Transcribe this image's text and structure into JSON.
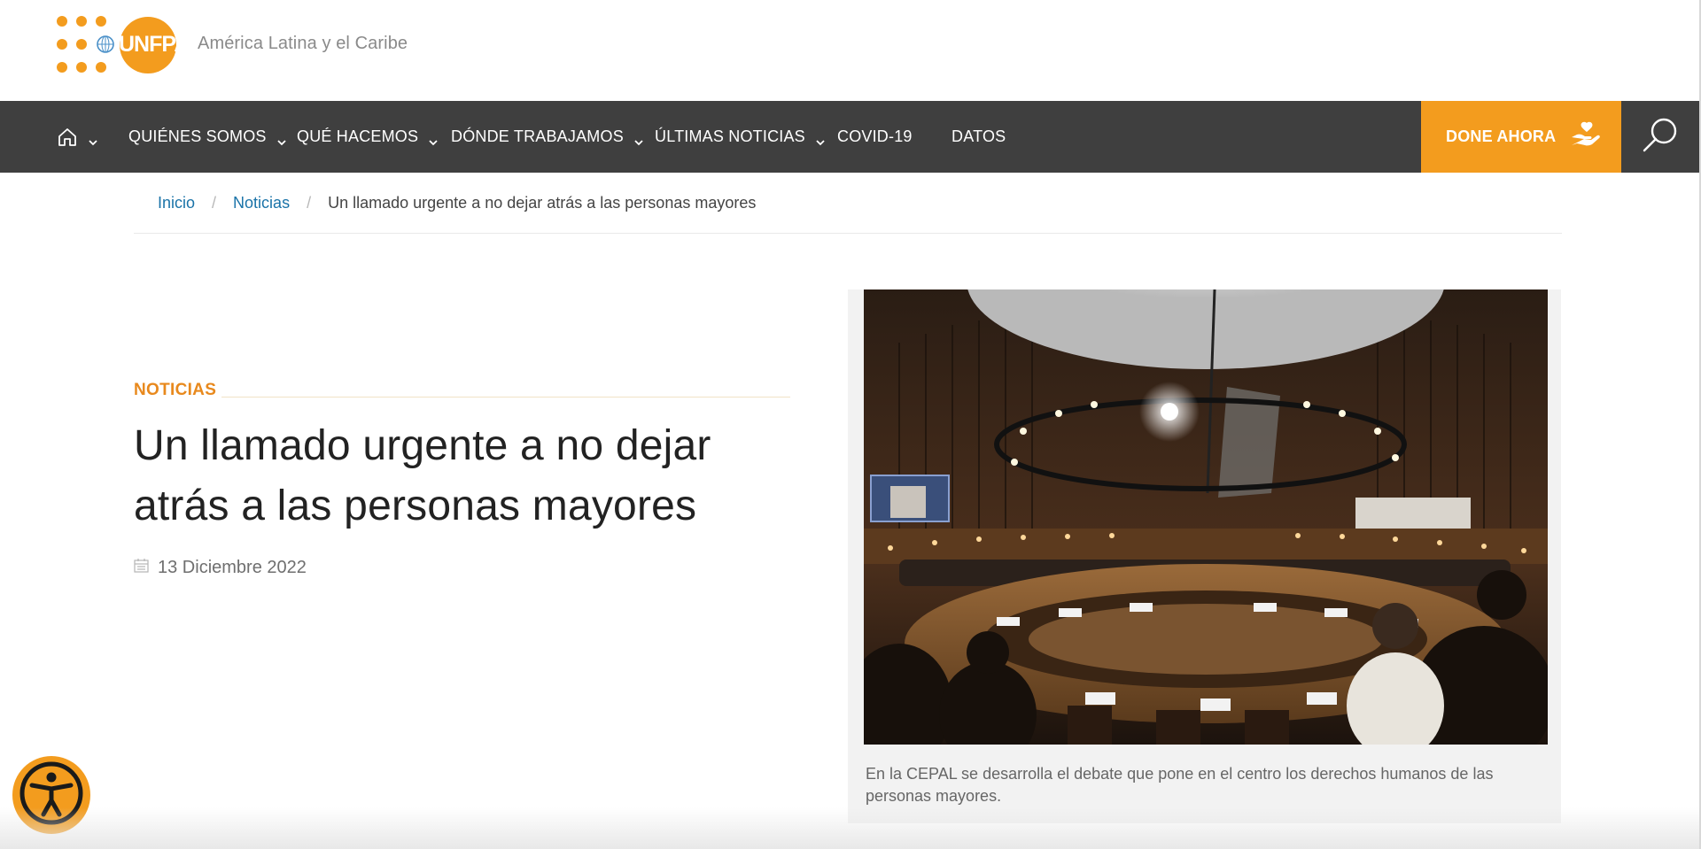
{
  "header": {
    "logo_text": "UNFPA",
    "region_name": "América Latina y el Caribe"
  },
  "nav": {
    "items": [
      {
        "label": "QUIÉNES SOMOS",
        "has_dropdown": true
      },
      {
        "label": "QUÉ HACEMOS",
        "has_dropdown": true
      },
      {
        "label": "DÓNDE TRABAJAMOS",
        "has_dropdown": true
      },
      {
        "label": "ÚLTIMAS NOTICIAS",
        "has_dropdown": true
      },
      {
        "label": "COVID-19",
        "has_dropdown": false
      },
      {
        "label": "DATOS",
        "has_dropdown": false
      }
    ],
    "home_icon": "home-icon",
    "donate_label": "DONE AHORA",
    "donate_icon": "hand-heart-icon",
    "search_icon": "search-icon"
  },
  "breadcrumb": {
    "items": [
      {
        "label": "Inicio"
      },
      {
        "label": "Noticias"
      }
    ],
    "current": "Un llamado urgente a no dejar atrás a las personas mayores",
    "separator": "/"
  },
  "article": {
    "category": "NOTICIAS",
    "title": "Un llamado urgente a no dejar atrás a las personas mayores",
    "date": "13 Diciembre 2022",
    "date_icon": "calendar-icon",
    "image_caption": "En la CEPAL se desarrolla el debate que pone en el centro los derechos humanos de las personas mayores."
  },
  "accessibility": {
    "icon": "accessibility-icon"
  },
  "colors": {
    "brand_orange": "#f39c1e",
    "nav_background": "#3f3f3f",
    "link_blue": "#1a73a8",
    "category_orange": "#e8891d"
  }
}
